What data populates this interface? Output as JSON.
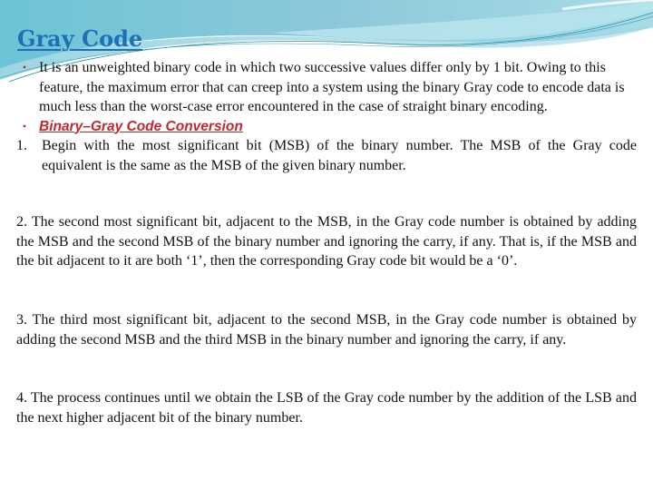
{
  "slide": {
    "title": "Gray Code",
    "colors": {
      "title": "#1f6fb8",
      "accent_red": "#c0282d",
      "header_teal": "#7cc6d8"
    },
    "bullets": [
      {
        "marker": "•",
        "text": "It is an unweighted binary code in which two successive values differ only by 1 bit. Owing to this feature, the maximum error that can creep into a system using the binary Gray code to encode data is much less than the worst-case error encountered in the case of straight binary encoding."
      },
      {
        "marker": "•",
        "text": "Binary–Gray Code Conversion"
      }
    ],
    "steps": [
      {
        "number": "1.",
        "text": "Begin with the most significant bit (MSB) of the binary number. The MSB of the Gray code equivalent is the same as the MSB of the given binary number."
      }
    ],
    "paragraphs": [
      "2. The second most significant bit, adjacent to the MSB, in the Gray code number is obtained by adding the MSB and the second MSB of the binary number and ignoring the carry, if any. That is, if the MSB and the bit adjacent to it are both ‘1’, then the corresponding Gray code bit would be a ‘0’.",
      "3. The third most significant bit, adjacent to the second MSB, in the Gray code number is obtained by adding the second MSB and the third MSB in the binary number and ignoring the carry, if any.",
      "4. The process continues until we obtain the LSB of the Gray code number by the addition of the LSB and the next higher adjacent bit of the binary number."
    ]
  }
}
